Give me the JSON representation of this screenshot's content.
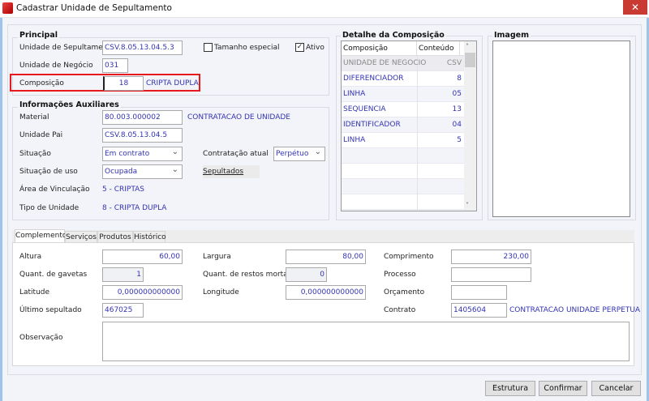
{
  "window": {
    "title": "Cadastrar Unidade de Sepultamento",
    "close_icon": "close-icon"
  },
  "principal": {
    "title": "Principal",
    "unidade_label": "Unidade de Sepultamento",
    "unidade_value": "CSV.8.05.13.04.5.3",
    "tamanho_label": "Tamanho especial",
    "tamanho_checked": false,
    "ativo_label": "Ativo",
    "ativo_checked": true,
    "negocio_label": "Unidade de Negócio",
    "negocio_value": "031",
    "composicao_label": "Composição",
    "composicao_value": "18",
    "composicao_desc": "CRIPTA DUPLA"
  },
  "aux": {
    "title": "Informações Auxiliares",
    "material_label": "Material",
    "material_value": "80.003.000002",
    "material_desc": "CONTRATACAO DE UNIDADE",
    "pai_label": "Unidade Pai",
    "pai_value": "CSV.8.05.13.04.5",
    "situacao_label": "Situação",
    "situacao_value": "Em contrato",
    "contratacao_label": "Contratação atual",
    "contratacao_value": "Perpétuo",
    "uso_label": "Situação de uso",
    "uso_value": "Ocupada",
    "sepultados_label": "Sepultados",
    "area_label": "Área de Vinculação",
    "area_value": "5 - CRIPTAS",
    "tipo_label": "Tipo de Unidade",
    "tipo_value": "8 - CRIPTA DUPLA"
  },
  "detalhe": {
    "title": "Detalhe da Composição",
    "columns": [
      "Composição",
      "Conteúdo"
    ],
    "rows": [
      [
        "UNIDADE DE NEGOCIO",
        "CSV"
      ],
      [
        "DIFERENCIADOR",
        "8"
      ],
      [
        "LINHA",
        "05"
      ],
      [
        "SEQUENCIA",
        "13"
      ],
      [
        "IDENTIFICADOR",
        "04"
      ],
      [
        "LINHA",
        "5"
      ]
    ]
  },
  "imagem": {
    "title": "Imagem"
  },
  "tabs": [
    "Complemento",
    "Serviços",
    "Produtos",
    "Histórico"
  ],
  "complemento": {
    "altura_label": "Altura",
    "altura_value": "60,00",
    "largura_label": "Largura",
    "largura_value": "80,00",
    "comprimento_label": "Comprimento",
    "comprimento_value": "230,00",
    "gavetas_label": "Quant. de gavetas",
    "gavetas_value": "1",
    "restos_label": "Quant. de restos mortais",
    "restos_value": "0",
    "processo_label": "Processo",
    "processo_value": "",
    "latitude_label": "Latitude",
    "latitude_value": "0,000000000000",
    "longitude_label": "Longitude",
    "longitude_value": "0,000000000000",
    "orcamento_label": "Orçamento",
    "orcamento_value": "",
    "ultimo_label": "Último sepultado",
    "ultimo_value": "467025",
    "contrato_label": "Contrato",
    "contrato_value": "1405604",
    "contrato_desc": "CONTRATACAO UNIDADE PERPETUA",
    "obs_label": "Observação",
    "obs_value": ""
  },
  "buttons": {
    "estrutura": "Estrutura",
    "confirmar": "Confirmar",
    "cancelar": "Cancelar"
  },
  "colors": {
    "value_text": "#3333b3",
    "highlight": "#e8191c",
    "close": "#c83a32"
  }
}
